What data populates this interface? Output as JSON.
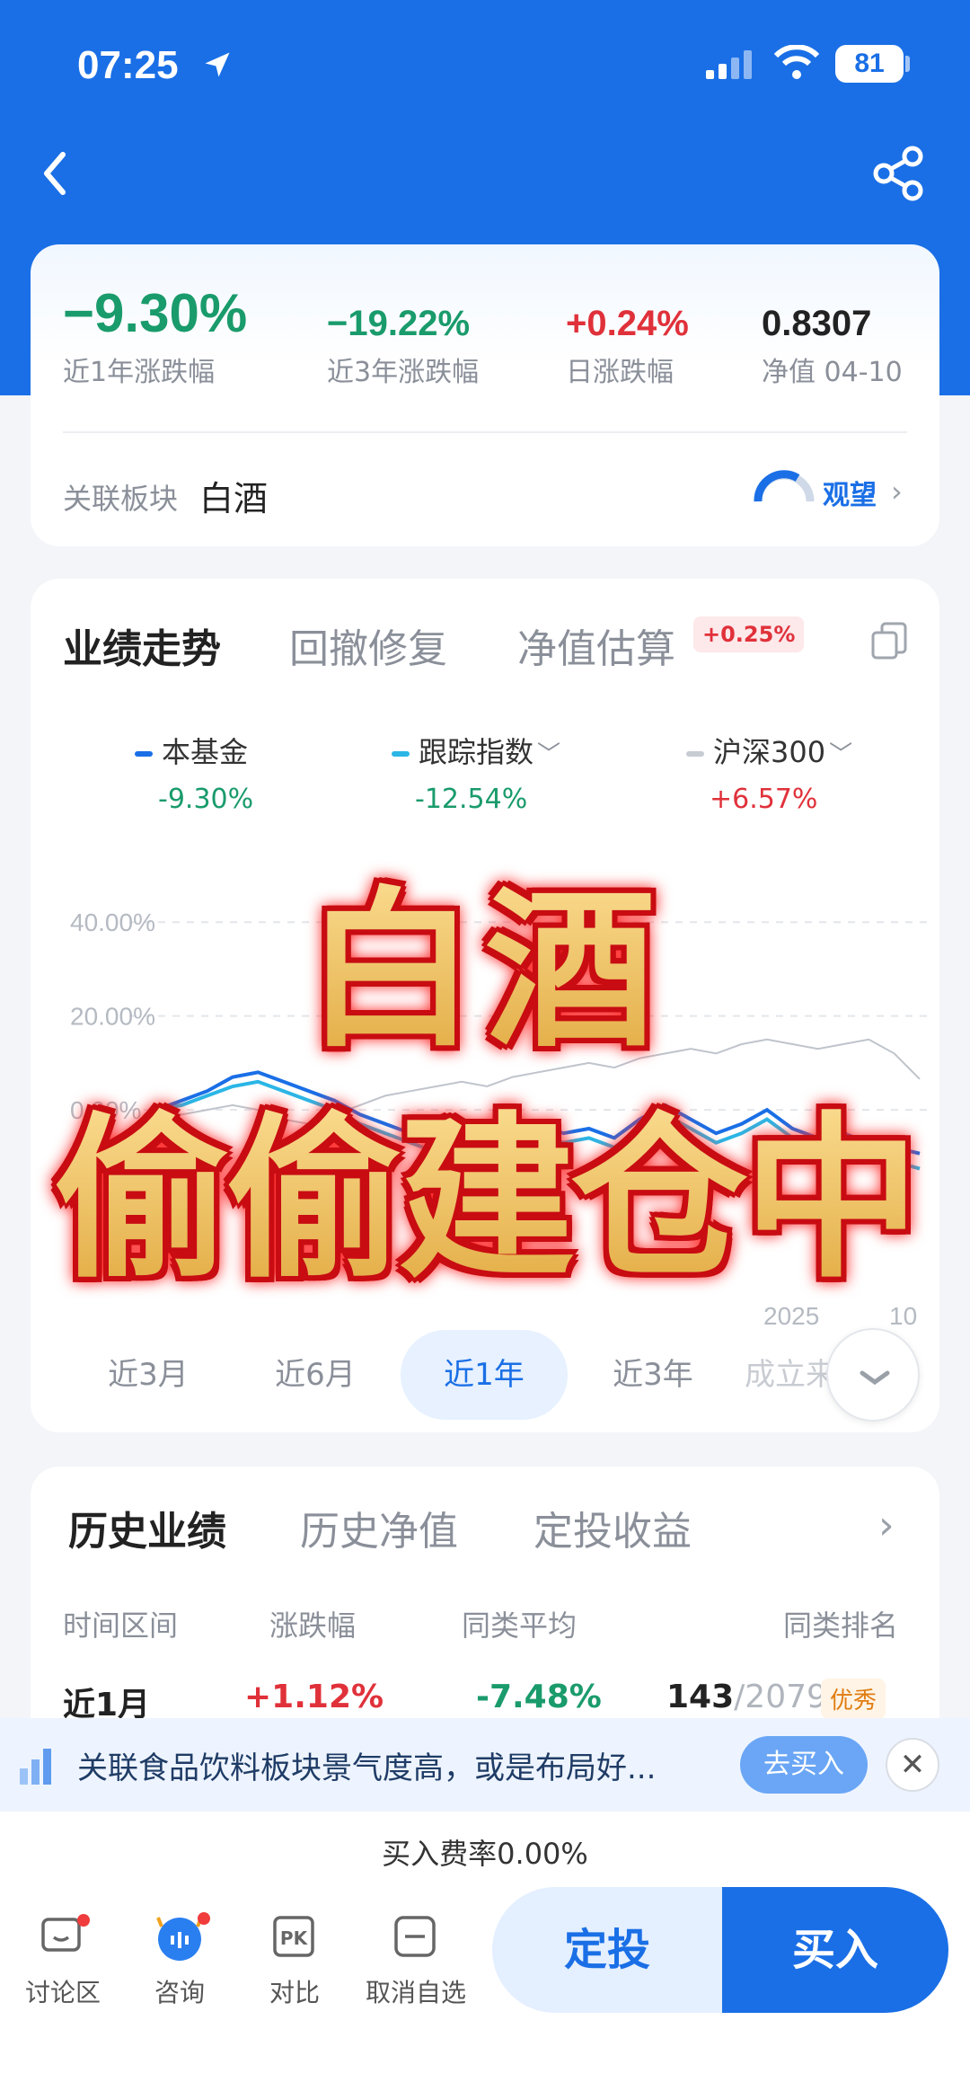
{
  "status": {
    "time": "07:25",
    "battery": "81"
  },
  "metrics": {
    "year1": {
      "value": "−9.30%",
      "label": "近1年涨跌幅"
    },
    "year3": {
      "value": "−19.22%",
      "label": "近3年涨跌幅"
    },
    "daily": {
      "value": "+0.24%",
      "label": "日涨跌幅"
    },
    "nav": {
      "value": "0.8307",
      "label": "净值 04-10"
    },
    "sector_label": "关联板块",
    "sector_name": "白酒",
    "mood": "观望"
  },
  "chart_tabs": [
    "业绩走势",
    "回撤修复",
    "净值估算"
  ],
  "estimate_badge": "+0.25%",
  "legend": [
    {
      "name": "本基金",
      "value": "-9.30%",
      "color": "#1a6fe6",
      "value_color": "#1a9b6c"
    },
    {
      "name": "跟踪指数",
      "value": "-12.54%",
      "color": "#2bb6e6",
      "value_color": "#1a9b6c"
    },
    {
      "name": "沪深300",
      "value": "+6.57%",
      "color": "#c7cbd2",
      "value_color": "#e0313a"
    }
  ],
  "chart_data": {
    "type": "line",
    "y_ticks": [
      "40.00%",
      "20.00%",
      "0.00%"
    ],
    "ylim": [
      -40,
      50
    ],
    "x_tick_partial": "2025",
    "x_tick_end_partial": "10",
    "series": [
      {
        "name": "本基金",
        "color": "#1a6fe6",
        "values": [
          0,
          2,
          4,
          7,
          8,
          6,
          4,
          2,
          -1,
          -3,
          -5,
          -7,
          -8,
          -6,
          -4,
          -3,
          -5,
          -4,
          -6,
          -2,
          1,
          -2,
          -5,
          -3,
          0,
          -4,
          -6,
          -5,
          -7,
          -8,
          -9.3
        ]
      },
      {
        "name": "跟踪指数",
        "color": "#2bb6e6",
        "values": [
          0,
          1,
          3,
          5,
          6,
          4,
          2,
          0,
          -3,
          -5,
          -7,
          -9,
          -10,
          -8,
          -6,
          -5,
          -7,
          -6,
          -8,
          -4,
          -1,
          -4,
          -7,
          -5,
          -2,
          -6,
          -8,
          -7,
          -9,
          -11,
          -12.54
        ]
      },
      {
        "name": "沪深300",
        "color": "#bfc4cc",
        "values": [
          0,
          -1,
          0,
          1,
          0,
          -2,
          -3,
          -1,
          1,
          3,
          4,
          5,
          6,
          5,
          7,
          8,
          9,
          10,
          9,
          11,
          12,
          13,
          12,
          14,
          15,
          14,
          13,
          14,
          15,
          12,
          6.57
        ]
      }
    ]
  },
  "ranges": [
    "近3月",
    "近6月",
    "近1年",
    "近3年",
    "成立来"
  ],
  "active_range": "近1年",
  "history": {
    "tabs": [
      "历史业绩",
      "历史净值",
      "定投收益"
    ],
    "headers": [
      "时间区间",
      "涨跌幅",
      "同类平均",
      "同类排名"
    ],
    "row": {
      "period": "近1月",
      "change": "+1.12%",
      "avg": "-7.48%",
      "rank": "143",
      "total": "/2079",
      "badge": "优秀"
    }
  },
  "promo": {
    "text": "关联食品饮料板块景气度高，或是布局好...",
    "button": "去买入"
  },
  "fee": "买入费率0.00%",
  "bottom_nav": [
    "讨论区",
    "咨询",
    "对比",
    "取消自选"
  ],
  "actions": {
    "sip": "定投",
    "buy": "买入"
  },
  "overlay": {
    "line1": "白酒",
    "line2": "偷偷建仓中"
  }
}
